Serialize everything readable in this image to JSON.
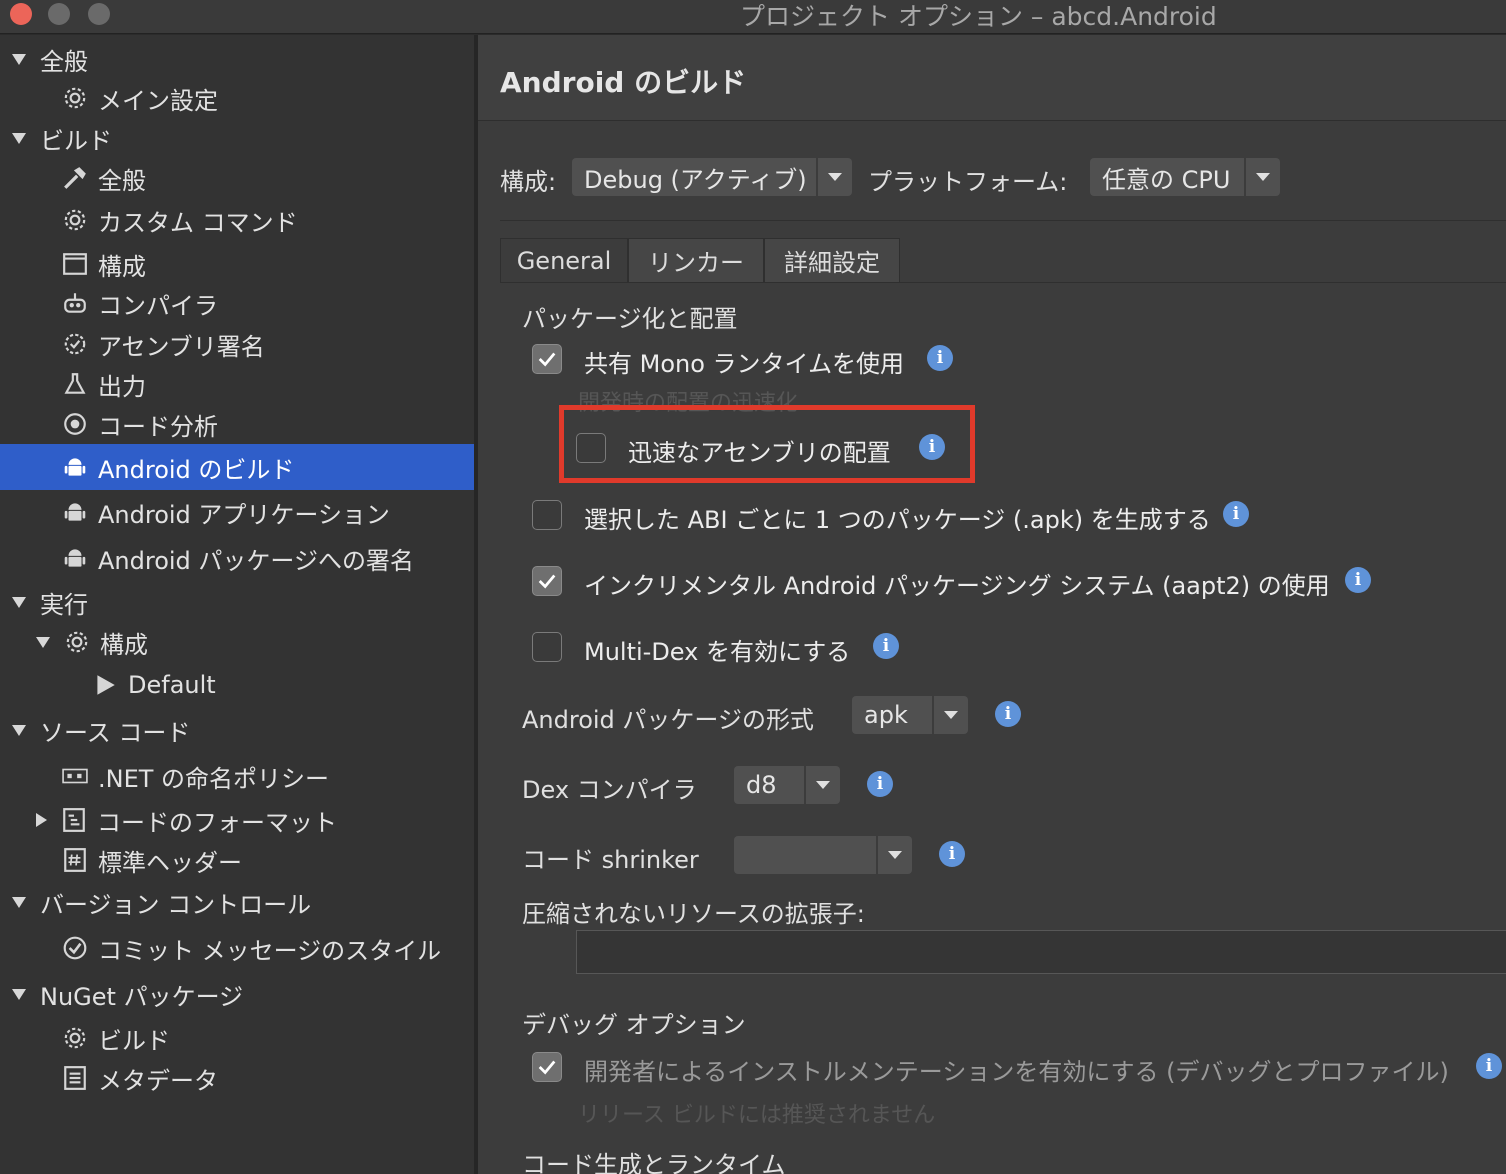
{
  "window": {
    "title": "プロジェクト オプション – abcd.Android"
  },
  "sidebar": {
    "groups": [
      {
        "label": "全般",
        "items": [
          {
            "label": "メイン設定"
          }
        ]
      },
      {
        "label": "ビルド",
        "items": [
          {
            "label": "全般"
          },
          {
            "label": "カスタム コマンド"
          },
          {
            "label": "構成"
          },
          {
            "label": "コンパイラ"
          },
          {
            "label": "アセンブリ署名"
          },
          {
            "label": "出力"
          },
          {
            "label": "コード分析"
          },
          {
            "label": "Android のビルド"
          },
          {
            "label": "Android アプリケーション"
          },
          {
            "label": "Android パッケージへの署名"
          }
        ]
      },
      {
        "label": "実行",
        "items": [
          {
            "label": "構成"
          },
          {
            "label": "Default"
          }
        ]
      },
      {
        "label": "ソース コード",
        "items": [
          {
            "label": ".NET の命名ポリシー"
          },
          {
            "label": "コードのフォーマット"
          },
          {
            "label": "標準ヘッダー"
          }
        ]
      },
      {
        "label": "バージョン コントロール",
        "items": [
          {
            "label": "コミット メッセージのスタイル"
          }
        ]
      },
      {
        "label": "NuGet パッケージ",
        "items": [
          {
            "label": "ビルド"
          },
          {
            "label": "メタデータ"
          }
        ]
      }
    ]
  },
  "main": {
    "title": "Android のビルド",
    "config_label": "構成:",
    "config_value": "Debug (アクティブ)",
    "platform_label": "プラットフォーム:",
    "platform_value": "任意の CPU",
    "tabs": [
      {
        "label": "General"
      },
      {
        "label": "リンカー"
      },
      {
        "label": "詳細設定"
      }
    ],
    "packaging": {
      "section": "パッケージ化と配置",
      "shared_mono": {
        "label": "共有 Mono ランタイムを使用",
        "checked": true
      },
      "dev_hint": "開発時の配置の迅速化",
      "fast_deploy": {
        "label": "迅速なアセンブリの配置",
        "checked": false
      },
      "per_abi": {
        "label": "選択した ABI ごとに 1 つのパッケージ (.apk) を生成する",
        "checked": false
      },
      "aapt2": {
        "label": "インクリメンタル Android パッケージング システム (aapt2) の使用",
        "checked": true
      },
      "multidex": {
        "label": "Multi-Dex を有効にする",
        "checked": false
      }
    },
    "package_format": {
      "label": "Android パッケージの形式",
      "value": "apk"
    },
    "dex_compiler": {
      "label": "Dex コンパイラ",
      "value": "d8"
    },
    "code_shrinker": {
      "label": "コード shrinker",
      "value": ""
    },
    "uncompressed": {
      "label": "圧縮されないリソースの拡張子:",
      "value": ""
    },
    "debug": {
      "section": "デバッグ オプション",
      "instrumentation": {
        "label": "開発者によるインストルメンテーションを有効にする (デバッグとプロファイル)",
        "checked": true
      },
      "hint": "リリース ビルドには推奨されません"
    },
    "codegen_section": "コード生成とランタイム",
    "info_glyph": "i"
  },
  "colors": {
    "selection": "#2f5ec9",
    "highlight": "#e03a2b",
    "info": "#5f93d9",
    "close": "#ec6559"
  }
}
